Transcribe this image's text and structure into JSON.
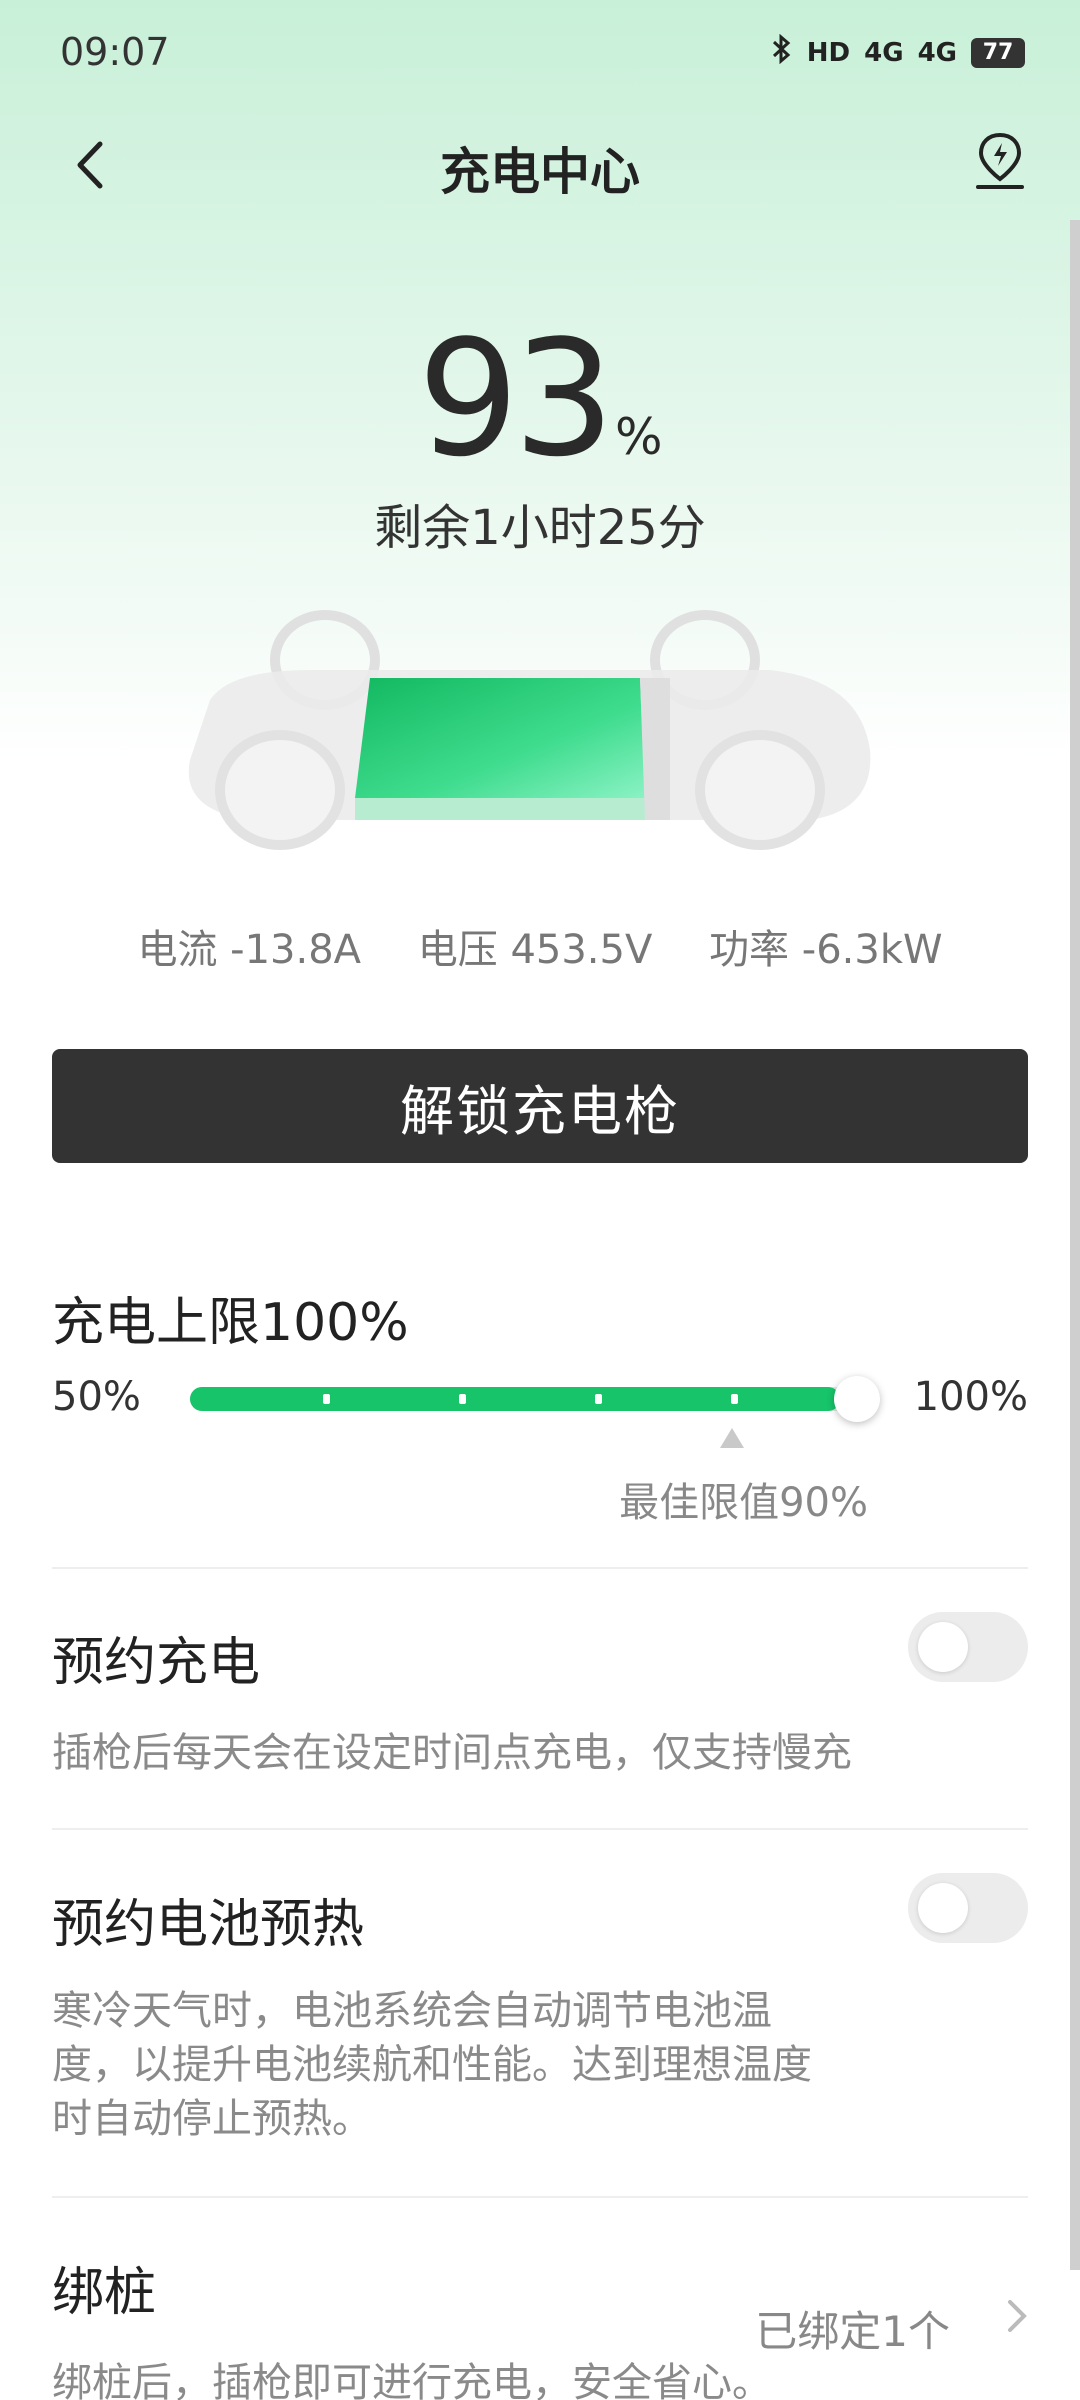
{
  "status_bar": {
    "time": "09:07",
    "icons": [
      "bluetooth-icon",
      "hd-icon",
      "signal-4g-icon",
      "signal-4g-icon"
    ],
    "labels": {
      "hd": "HD",
      "net1": "4G",
      "net2": "4G"
    },
    "battery": "77"
  },
  "header": {
    "title": "充电中心"
  },
  "charge": {
    "percent": "93",
    "percent_unit": "%",
    "remaining": "剩余1小时25分",
    "current": "电流 -13.8A",
    "voltage": "电压 453.5V",
    "power": "功率 -6.3kW",
    "battery_fill_color": "#17c46a"
  },
  "unlock_button": {
    "label": "解锁充电枪"
  },
  "limit": {
    "title": "充电上限100%",
    "min_label": "50%",
    "max_label": "100%",
    "value_percent": 100,
    "best_label": "最佳限值90%",
    "accent": "#17c46a"
  },
  "schedule_charge": {
    "title": "预约充电",
    "desc": "插枪后每天会在设定时间点充电，仅支持慢充",
    "enabled": false
  },
  "preheat": {
    "title": "预约电池预热",
    "desc_line1": "寒冷天气时，电池系统会自动调节电池温",
    "desc_line2": "度，以提升电池续航和性能。达到理想温度",
    "desc_line3": "时自动停止预热。",
    "enabled": false
  },
  "bind_pile": {
    "title": "绑桩",
    "status": "已绑定1个",
    "desc": "绑桩后，插枪即可进行充电，安全省心。"
  }
}
